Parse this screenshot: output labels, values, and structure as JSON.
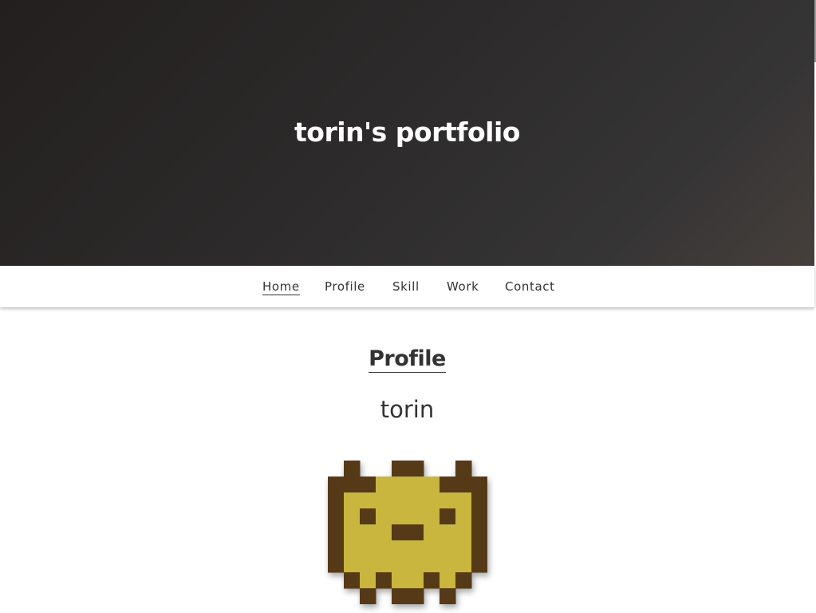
{
  "hero": {
    "title": "torin's portfolio"
  },
  "nav": {
    "items": [
      {
        "label": "Home",
        "active": true
      },
      {
        "label": "Profile",
        "active": false
      },
      {
        "label": "Skill",
        "active": false
      },
      {
        "label": "Work",
        "active": false
      },
      {
        "label": "Contact",
        "active": false
      }
    ]
  },
  "profile": {
    "heading": "Profile",
    "name": "torin"
  },
  "avatar": {
    "icon": "pixel-creature-avatar",
    "colors": {
      "outline": "#563a18",
      "fill": "#c8b63e"
    }
  }
}
